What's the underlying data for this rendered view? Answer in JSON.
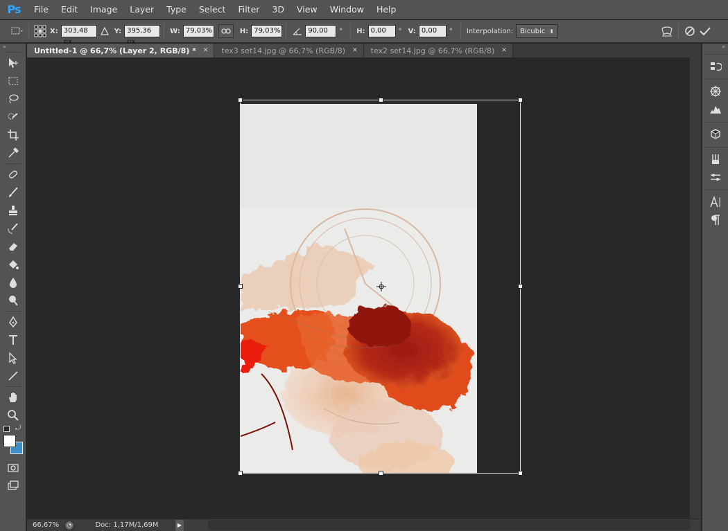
{
  "app": {
    "logo": "Ps"
  },
  "menu": [
    "File",
    "Edit",
    "Image",
    "Layer",
    "Type",
    "Select",
    "Filter",
    "3D",
    "View",
    "Window",
    "Help"
  ],
  "options": {
    "x_label": "X:",
    "x_value": "303,48 px",
    "y_label": "Y:",
    "y_value": "395,36 px",
    "w_label": "W:",
    "w_value": "79,03%",
    "h_label": "H:",
    "h_value": "79,03%",
    "angle_value": "90,00",
    "angle_unit": "°",
    "hskew_label": "H:",
    "hskew_value": "0,00",
    "hskew_unit": "°",
    "vskew_label": "V:",
    "vskew_value": "0,00",
    "vskew_unit": "°",
    "interp_label": "Interpolation:",
    "interp_value": "Bicubic"
  },
  "tabs": [
    {
      "label": "Untitled-1 @ 66,7% (Layer 2, RGB/8) *",
      "active": true
    },
    {
      "label": "tex3 set14.jpg @ 66,7% (RGB/8)",
      "active": false
    },
    {
      "label": "tex2 set14.jpg @ 66,7% (RGB/8)",
      "active": false
    }
  ],
  "status": {
    "zoom": "66,67%",
    "doc": "Doc: 1,17M/1,69M"
  },
  "colors": {
    "foreground": "#ffffff",
    "background": "#3c8fc6",
    "accent": "#31a8ff"
  }
}
